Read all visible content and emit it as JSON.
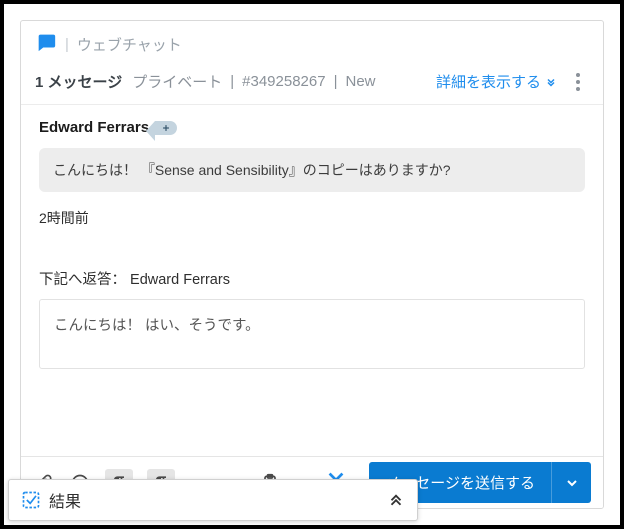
{
  "header": {
    "channel_label": "ウェブチャット"
  },
  "meta": {
    "count_label": "1 メッセージ",
    "privacy": "プライベート",
    "ticket_id": "#349258267",
    "status": "New",
    "details_link": "詳細を表示する"
  },
  "conversation": {
    "sender_name": "Edward Ferrars",
    "message_text": "こんにちは！ 『Sense and Sensibility』のコピーはありますか?",
    "timestamp": "2時間前"
  },
  "reply": {
    "label_prefix": "下記へ返答：",
    "recipient": "Edward Ferrars",
    "draft_text": "こんにちは！ はい、そうです。"
  },
  "toolbar": {
    "send_label": "メッセージを送信する"
  },
  "results_panel": {
    "label": "結果"
  }
}
